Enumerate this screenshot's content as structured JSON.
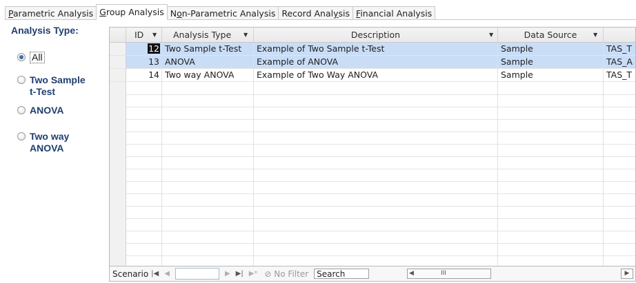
{
  "tabs": [
    {
      "pre": "",
      "u": "P",
      "post": "arametric Analysis"
    },
    {
      "pre": "",
      "u": "G",
      "post": "roup Analysis"
    },
    {
      "pre": "N",
      "u": "o",
      "post": "n-Parametric Analysis"
    },
    {
      "pre": "Record Anal",
      "u": "y",
      "post": "sis"
    },
    {
      "pre": "",
      "u": "F",
      "post": "inancial Analysis"
    }
  ],
  "sidebar": {
    "title": "Analysis Type:",
    "options": [
      {
        "label": "All",
        "selected": true
      },
      {
        "label_line1": "Two Sample",
        "label_line2": "t-Test",
        "selected": false
      },
      {
        "label": "ANOVA",
        "selected": false
      },
      {
        "label_line1": "Two way",
        "label_line2": "ANOVA",
        "selected": false
      }
    ]
  },
  "grid": {
    "columns": [
      "ID",
      "Analysis Type",
      "Description",
      "Data Source",
      ""
    ],
    "rows": [
      {
        "id": "12",
        "type": "Two Sample t-Test",
        "description": "Example of Two Sample t-Test",
        "source": "Sample",
        "extra": "TAS_T"
      },
      {
        "id": "13",
        "type": "ANOVA",
        "description": "Example of ANOVA",
        "source": "Sample",
        "extra": "TAS_A"
      },
      {
        "id": "14",
        "type": "Two way ANOVA",
        "description": "Example of Two Way ANOVA",
        "source": "Sample",
        "extra": "TAS_T"
      }
    ]
  },
  "nav": {
    "label": "Scenario",
    "filter": "No Filter",
    "search": "Search",
    "scroll_mark": "III"
  },
  "colors": {
    "accent": "#1f3f6e",
    "selection": "#c9ddf7"
  }
}
